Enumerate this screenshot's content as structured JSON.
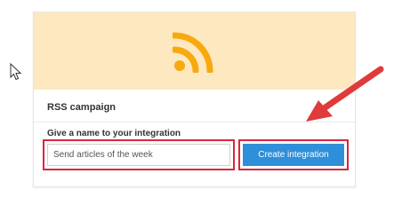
{
  "card": {
    "title": "RSS campaign",
    "field_label": "Give a name to your integration",
    "name_value": "Send articles of the week",
    "create_label": "Create integration"
  },
  "icons": {
    "hero": "rss-icon",
    "pointer": "mouse-pointer-icon",
    "annotation": "red-arrow-icon"
  },
  "colors": {
    "hero_background": "#fde8c0",
    "rss_icon": "#f7a90d",
    "primary_button": "#2f8fd8",
    "highlight_border": "#d9263b",
    "annotation_arrow": "#e03a3a"
  }
}
